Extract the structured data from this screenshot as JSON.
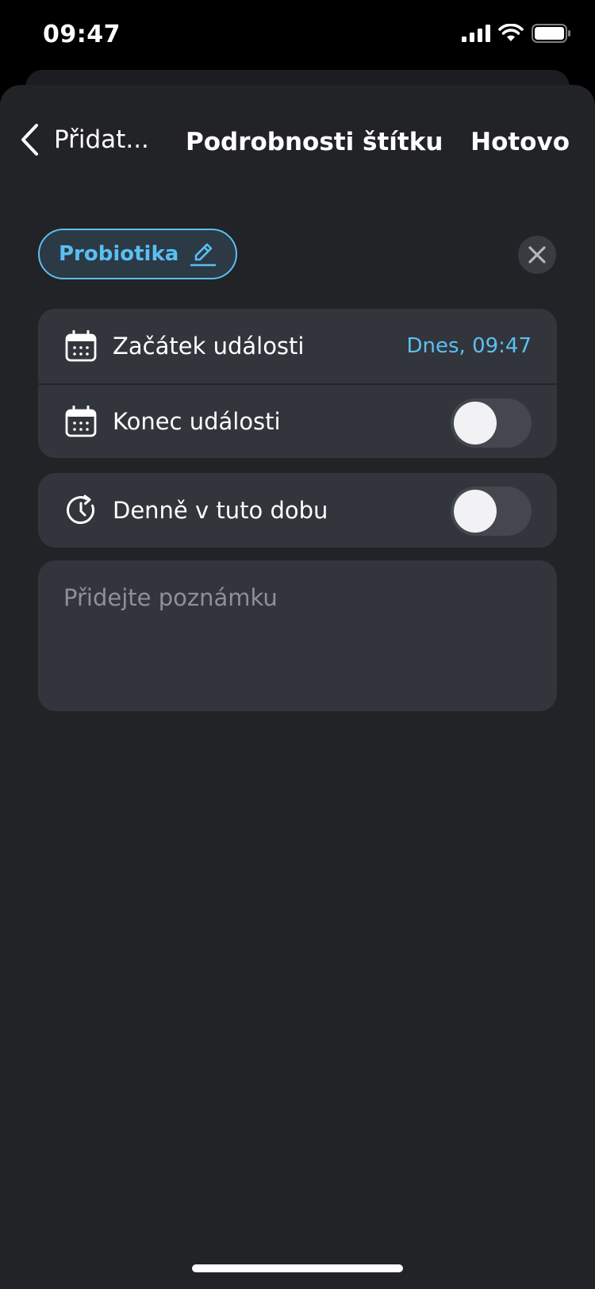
{
  "status_bar": {
    "time": "09:47"
  },
  "nav": {
    "back_label": "Přidat...",
    "title": "Podrobnosti štítku",
    "done_label": "Hotovo"
  },
  "tag": {
    "label": "Probiotika"
  },
  "event_card": {
    "start": {
      "label": "Začátek události",
      "value": "Dnes, 09:47"
    },
    "end": {
      "label": "Konec události",
      "toggle_on": false
    }
  },
  "repeat_card": {
    "label": "Denně v tuto dobu",
    "toggle_on": false
  },
  "note": {
    "placeholder": "Přidejte poznámku"
  },
  "icons": {
    "back": "chevron-left-icon",
    "edit": "pencil-icon",
    "close": "close-icon",
    "calendar": "calendar-icon",
    "repeat": "clock-repeat-icon"
  },
  "colors": {
    "accent": "#5bbff2",
    "background": "#222327",
    "card": "#33353c",
    "toggle_off": "#45474f"
  }
}
